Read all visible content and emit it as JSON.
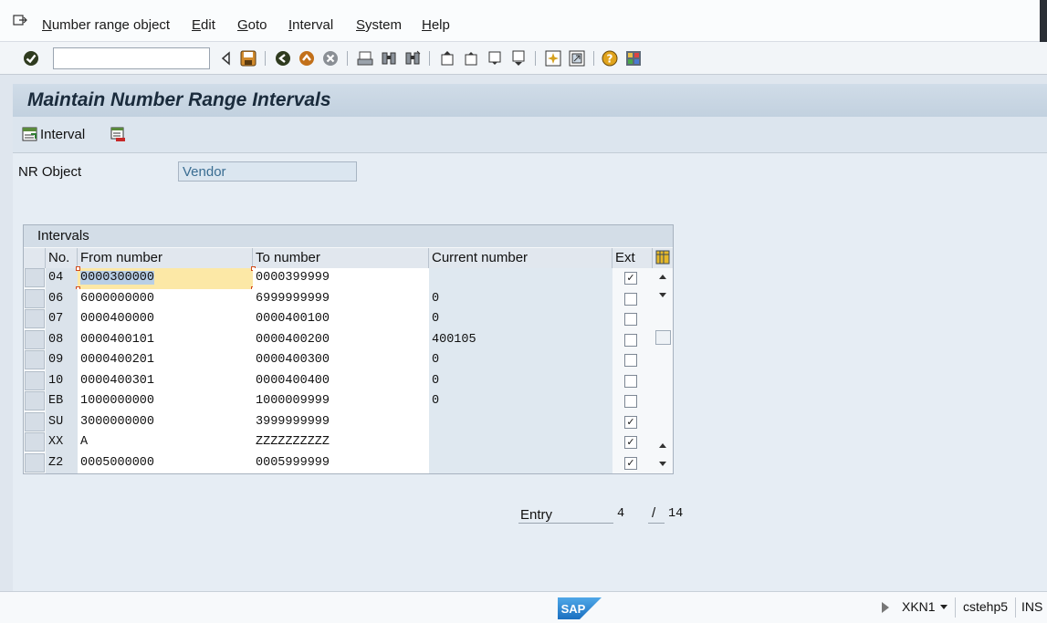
{
  "menu": {
    "items": [
      {
        "label": "Number range object"
      },
      {
        "label": "Edit"
      },
      {
        "label": "Goto"
      },
      {
        "label": "Interval"
      },
      {
        "label": "System"
      },
      {
        "label": "Help"
      }
    ]
  },
  "toolbar": {
    "command_field_value": "",
    "icons": [
      "enter-icon",
      "back-icon",
      "save-icon",
      "back-green-icon",
      "exit-icon",
      "cancel-icon",
      "print-icon",
      "find-icon",
      "find-next-icon",
      "first-page-icon",
      "previous-page-icon",
      "next-page-icon",
      "last-page-icon",
      "create-session-icon",
      "shortcut-icon",
      "help-icon",
      "customize-layout-icon"
    ]
  },
  "title": "Maintain Number Range Intervals",
  "app_toolbar": {
    "interval_button": "Interval",
    "icons": [
      "insert-interval-icon",
      "delete-interval-icon"
    ]
  },
  "nr_object": {
    "label": "NR Object",
    "value": "Vendor"
  },
  "intervals": {
    "title": "Intervals",
    "columns": {
      "no": "No.",
      "from": "From number",
      "to": "To number",
      "current": "Current number",
      "ext": "Ext"
    },
    "rows": [
      {
        "no": "04",
        "from": "0000300000",
        "to": "0000399999",
        "current": "",
        "ext": true
      },
      {
        "no": "06",
        "from": "6000000000",
        "to": "6999999999",
        "current": "0",
        "ext": false
      },
      {
        "no": "07",
        "from": "0000400000",
        "to": "0000400100",
        "current": "0",
        "ext": false
      },
      {
        "no": "08",
        "from": "0000400101",
        "to": "0000400200",
        "current": "400105",
        "ext": false
      },
      {
        "no": "09",
        "from": "0000400201",
        "to": "0000400300",
        "current": "0",
        "ext": false
      },
      {
        "no": "10",
        "from": "0000400301",
        "to": "0000400400",
        "current": "0",
        "ext": false
      },
      {
        "no": "EB",
        "from": "1000000000",
        "to": "1000009999",
        "current": "0",
        "ext": false
      },
      {
        "no": "SU",
        "from": "3000000000",
        "to": "3999999999",
        "current": "",
        "ext": true
      },
      {
        "no": "XX",
        "from": "A",
        "to": "ZZZZZZZZZZ",
        "current": "",
        "ext": true
      },
      {
        "no": "Z2",
        "from": "0005000000",
        "to": "0005999999",
        "current": "",
        "ext": true
      }
    ]
  },
  "entry": {
    "label": "Entry",
    "current": "4",
    "separator": "/",
    "total": "14"
  },
  "status": {
    "logo": "SAP",
    "transaction": "XKN1",
    "server": "cstehp5",
    "mode": "INS"
  }
}
